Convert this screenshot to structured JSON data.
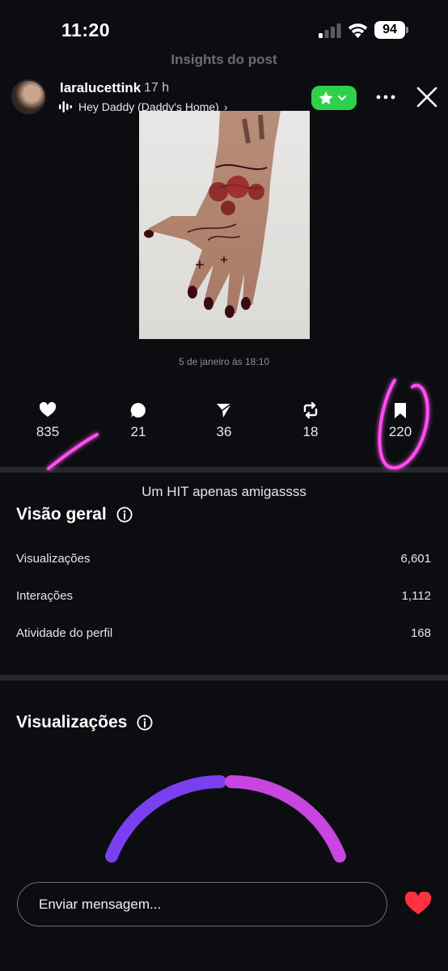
{
  "status_bar": {
    "time": "11:20",
    "battery": "94"
  },
  "ghost_header": {
    "title": "Insights do post"
  },
  "story": {
    "username": "laralucettink",
    "time_ago": "17 h",
    "music": "Hey Daddy (Daddy's Home)",
    "music_chevron": "›",
    "posted_at": "5 de janeiro às 18:10"
  },
  "metrics": [
    {
      "icon": "heart-icon",
      "value": "835"
    },
    {
      "icon": "comment-icon",
      "value": "21"
    },
    {
      "icon": "share-icon",
      "value": "36"
    },
    {
      "icon": "repost-icon",
      "value": "18"
    },
    {
      "icon": "bookmark-icon",
      "value": "220"
    }
  ],
  "caption": "Um HIT apenas amigassss",
  "overview": {
    "title": "Visão geral",
    "rows": [
      {
        "label": "Visualizações",
        "value": "6,601"
      },
      {
        "label": "Interações",
        "value": "1,112"
      },
      {
        "label": "Atividade do perfil",
        "value": "168"
      }
    ]
  },
  "views_section": {
    "title": "Visualizações"
  },
  "message": {
    "placeholder": "Enviar mensagem..."
  },
  "colors": {
    "background": "#0b0d10",
    "close_friends_green": "#2fd14b",
    "gauge_purple": "#7b3ff2",
    "gauge_magenta": "#c845e0",
    "heart_red": "#ff3040",
    "highlight_pink": "#ff4ef0"
  }
}
